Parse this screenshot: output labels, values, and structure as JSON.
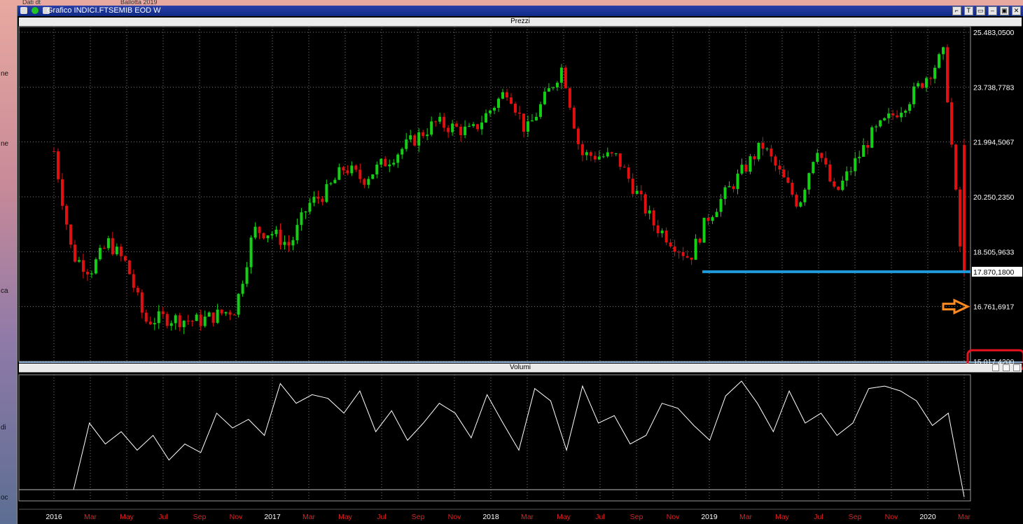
{
  "window": {
    "title": "Grafico INDICI.FTSEMIB EOD W",
    "buttons": [
      "⌐",
      "T",
      "▭",
      "–",
      "▣",
      "✕"
    ]
  },
  "desktop": {
    "top_text": [
      "Dati  dt",
      "Ballotta 2019"
    ],
    "side_text": [
      "ne",
      "ne",
      "ca",
      "di",
      "oc"
    ]
  },
  "panels": {
    "price_label": "Prezzi",
    "volume_label": "Volumi"
  },
  "colors": {
    "up": "#14d014",
    "down": "#e01010",
    "support_line": "#1f9bdc",
    "arrow": "#ff8a1e",
    "highlight_box": "#e8121e",
    "grid": "#7a7a7a",
    "volume_line": "#ffffff"
  },
  "annotations": {
    "support_value": "17.870,1800",
    "arrow_target_value": "16.761,6917",
    "highlighted_value": "15.017,4200"
  },
  "chart_data": [
    {
      "type": "candlestick",
      "title": "Prezzi",
      "instrument": "INDICI.FTSEMIB",
      "timeframe": "weekly",
      "y_tick_labels": [
        "25.483,0500",
        "23.738,7783",
        "21.994,5067",
        "20.250,2350",
        "18.505,9633",
        "17.870,1800",
        "16.761,6917",
        "15.017,4200"
      ],
      "ylim": [
        15017.42,
        25483.05
      ],
      "x_tick_labels": [
        "2016",
        "Mar",
        "May",
        "Jul",
        "Sep",
        "Nov",
        "2017",
        "Mar",
        "May",
        "Jul",
        "Sep",
        "Nov",
        "2018",
        "Mar",
        "May",
        "Jul",
        "Sep",
        "Nov",
        "2019",
        "Mar",
        "May",
        "Jul",
        "Sep",
        "Nov",
        "2020",
        "Mar"
      ],
      "x_range": [
        "2016-01",
        "2020-03"
      ],
      "grid": true,
      "anchors": [
        {
          "date": "2016-01",
          "value": 21700
        },
        {
          "date": "2016-02",
          "value": 18400
        },
        {
          "date": "2016-03",
          "value": 17900
        },
        {
          "date": "2016-04",
          "value": 18800
        },
        {
          "date": "2016-05",
          "value": 18100
        },
        {
          "date": "2016-06",
          "value": 16300
        },
        {
          "date": "2016-07",
          "value": 16400
        },
        {
          "date": "2016-09",
          "value": 16300
        },
        {
          "date": "2016-11",
          "value": 16700
        },
        {
          "date": "2016-12",
          "value": 19200
        },
        {
          "date": "2017-01",
          "value": 19100
        },
        {
          "date": "2017-02",
          "value": 18700
        },
        {
          "date": "2017-03",
          "value": 20000
        },
        {
          "date": "2017-04",
          "value": 20400
        },
        {
          "date": "2017-05",
          "value": 21200
        },
        {
          "date": "2017-06",
          "value": 20800
        },
        {
          "date": "2017-08",
          "value": 21700
        },
        {
          "date": "2017-10",
          "value": 22600
        },
        {
          "date": "2017-12",
          "value": 22300
        },
        {
          "date": "2018-02",
          "value": 23700
        },
        {
          "date": "2018-03",
          "value": 22300
        },
        {
          "date": "2018-05",
          "value": 24400
        },
        {
          "date": "2018-06",
          "value": 21600
        },
        {
          "date": "2018-08",
          "value": 21500
        },
        {
          "date": "2018-10",
          "value": 19400
        },
        {
          "date": "2018-12",
          "value": 18300
        },
        {
          "date": "2019-01",
          "value": 19600
        },
        {
          "date": "2019-04",
          "value": 21900
        },
        {
          "date": "2019-06",
          "value": 20000
        },
        {
          "date": "2019-07",
          "value": 21900
        },
        {
          "date": "2019-08",
          "value": 20300
        },
        {
          "date": "2019-10",
          "value": 22200
        },
        {
          "date": "2019-12",
          "value": 23300
        },
        {
          "date": "2020-02",
          "value": 24800
        },
        {
          "date": "2020-03",
          "value": 17870
        }
      ],
      "last_close": 17870.18
    },
    {
      "type": "line",
      "title": "Volumi",
      "series": [
        {
          "values": [
            0.08,
            0.62,
            0.45,
            0.55,
            0.4,
            0.52,
            0.32,
            0.45,
            0.38,
            0.7,
            0.58,
            0.65,
            0.52,
            0.94,
            0.78,
            0.85,
            0.82,
            0.7,
            0.88,
            0.55,
            0.72,
            0.48,
            0.62,
            0.78,
            0.7,
            0.5,
            0.85,
            0.62,
            0.4,
            0.9,
            0.8,
            0.4,
            0.92,
            0.62,
            0.68,
            0.45,
            0.52,
            0.78,
            0.74,
            0.6,
            0.48,
            0.84,
            0.96,
            0.78,
            0.55,
            0.88,
            0.62,
            0.7,
            0.52,
            0.62,
            0.9,
            0.92,
            0.88,
            0.8,
            0.6,
            0.7,
            0.02
          ]
        }
      ]
    }
  ]
}
